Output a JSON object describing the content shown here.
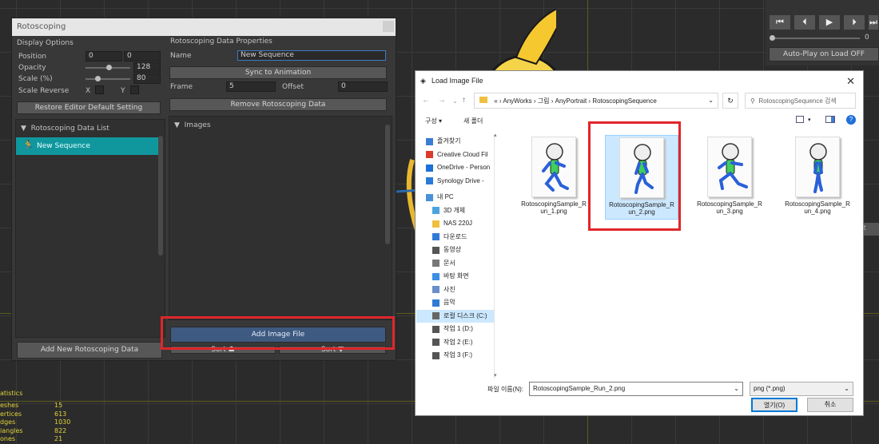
{
  "roto_window": {
    "title": "Rotoscoping",
    "display_options": "Display Options",
    "position_label": "Position",
    "position_x": "0",
    "position_y": "0",
    "opacity_label": "Opacity",
    "opacity_value": "128",
    "scale_label": "Scale (%)",
    "scale_value": "80",
    "scale_reverse_label": "Scale Reverse",
    "x_label": "X",
    "y_label": "Y",
    "restore_button": "Restore Editor Default Setting",
    "data_list_header": "Rotoscoping Data List",
    "list_item": "New Sequence",
    "add_data_button": "Add New Rotoscoping Data",
    "props_header": "Rotoscoping Data Properties",
    "name_label": "Name",
    "name_value": "New Sequence",
    "sync_button": "Sync to Animation",
    "frame_label": "Frame",
    "frame_value": "5",
    "offset_label": "Offset",
    "offset_value": "0",
    "remove_button": "Remove Rotoscoping Data",
    "images_header": "Images",
    "add_image_button": "Add Image File",
    "sort_left": "Sort ☗",
    "sort_right": "Sort ▼"
  },
  "transport": {
    "timeline_value": "0",
    "autoplay_button": "Auto-Play on Load OFF",
    "partial_label": "it"
  },
  "stats": {
    "title": "atistics",
    "rows": [
      {
        "label": "eshes",
        "value": "15"
      },
      {
        "label": "ertices",
        "value": "613"
      },
      {
        "label": "dges",
        "value": "1030"
      },
      {
        "label": "iangles",
        "value": "822"
      },
      {
        "label": "ones",
        "value": "21"
      }
    ]
  },
  "dialog": {
    "title": "Load Image File",
    "breadcrumb": [
      "«",
      "AnyWorks",
      "그림",
      "AnyPortrait",
      "RotoscopingSequence"
    ],
    "search_placeholder": "RotoscopingSequence 검색",
    "organize": "구성 ▾",
    "new_folder": "새 폴더",
    "nav_items": [
      {
        "label": "즐겨찾기",
        "icon": "star-icon",
        "color": "#3a7bd5"
      },
      {
        "label": "Creative Cloud Fil",
        "icon": "cloud-icon",
        "color": "#da3b2a"
      },
      {
        "label": "OneDrive - Person",
        "icon": "cloud-icon",
        "color": "#1e6fd9"
      },
      {
        "label": "Synology Drive -",
        "icon": "drive-icon",
        "color": "#2a7ad8"
      },
      {
        "label": "내 PC",
        "icon": "pc-icon",
        "color": "#4a90d9"
      },
      {
        "label": "3D 개체",
        "icon": "cube-icon",
        "color": "#4aa3df"
      },
      {
        "label": "NAS 220J",
        "icon": "folder-icon",
        "color": "#f0c040"
      },
      {
        "label": "다운로드",
        "icon": "download-icon",
        "color": "#2f7ad6"
      },
      {
        "label": "동영상",
        "icon": "video-icon",
        "color": "#555"
      },
      {
        "label": "문서",
        "icon": "document-icon",
        "color": "#777"
      },
      {
        "label": "바탕 화면",
        "icon": "desktop-icon",
        "color": "#3a8ee6"
      },
      {
        "label": "사진",
        "icon": "picture-icon",
        "color": "#6a8ec8"
      },
      {
        "label": "음악",
        "icon": "music-icon",
        "color": "#2f7ad6"
      },
      {
        "label": "로컬 디스크 (C:)",
        "icon": "disk-icon",
        "color": "#666"
      },
      {
        "label": "작업 1 (D:)",
        "icon": "disk-icon",
        "color": "#555"
      },
      {
        "label": "작업 2 (E:)",
        "icon": "disk-icon",
        "color": "#555"
      },
      {
        "label": "작업 3 (F:)",
        "icon": "disk-icon",
        "color": "#555"
      }
    ],
    "files": [
      {
        "line1": "RotoscopingSample_R",
        "line2": "un_1.png"
      },
      {
        "line1": "RotoscopingSample_R",
        "line2": "un_2.png"
      },
      {
        "line1": "RotoscopingSample_R",
        "line2": "un_3.png"
      },
      {
        "line1": "RotoscopingSample_R",
        "line2": "un_4.png"
      }
    ],
    "filename_label": "파일 이름(N):",
    "filename_value": "RotoscopingSample_Run_2.png",
    "filetype_value": "png (*.png)",
    "open_button": "열기(O)",
    "cancel_button": "취소"
  },
  "colors": {
    "highlight_red": "#e0262a",
    "list_selected": "#10979e",
    "file_selected": "#cce8ff",
    "stats_yellow": "#e0d23a"
  }
}
